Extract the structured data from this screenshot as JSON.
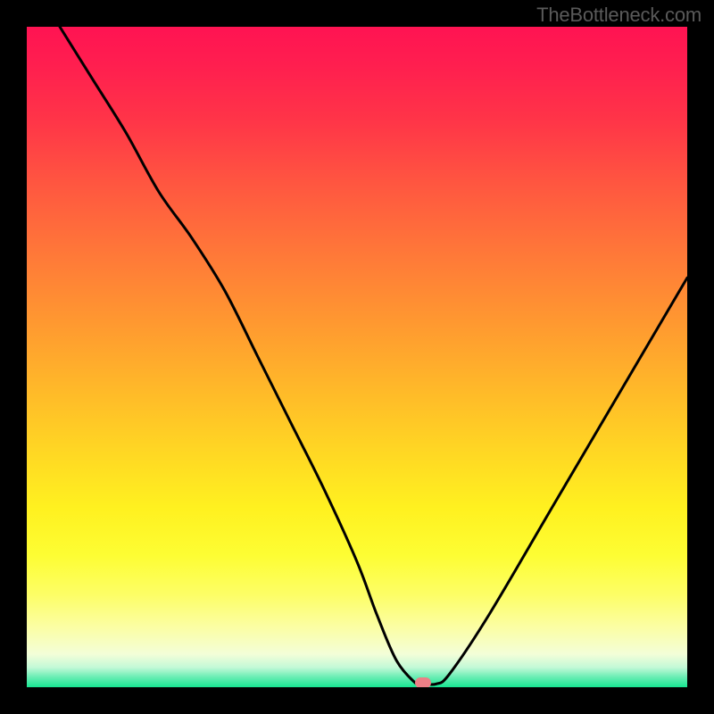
{
  "watermark_text": "TheBottleneck.com",
  "chart_data": {
    "type": "line",
    "title": "",
    "xlabel": "",
    "ylabel": "",
    "xlim": [
      0,
      100
    ],
    "ylim": [
      0,
      100
    ],
    "series": [
      {
        "name": "bottleneck-curve",
        "x": [
          5,
          10,
          15,
          20,
          25,
          30,
          35,
          40,
          45,
          50,
          53,
          56,
          59,
          60,
          62,
          64,
          70,
          80,
          90,
          100
        ],
        "y": [
          100,
          92,
          84,
          75,
          68,
          60,
          50,
          40,
          30,
          19,
          11,
          4,
          0.5,
          0.5,
          0.5,
          2,
          11,
          28,
          45,
          62
        ]
      }
    ],
    "marker": {
      "x": 60,
      "y": 0.7
    },
    "gradient": {
      "top_color": "#ff1352",
      "mid_color": "#ffd923",
      "bottom_color": "#17e691"
    }
  }
}
